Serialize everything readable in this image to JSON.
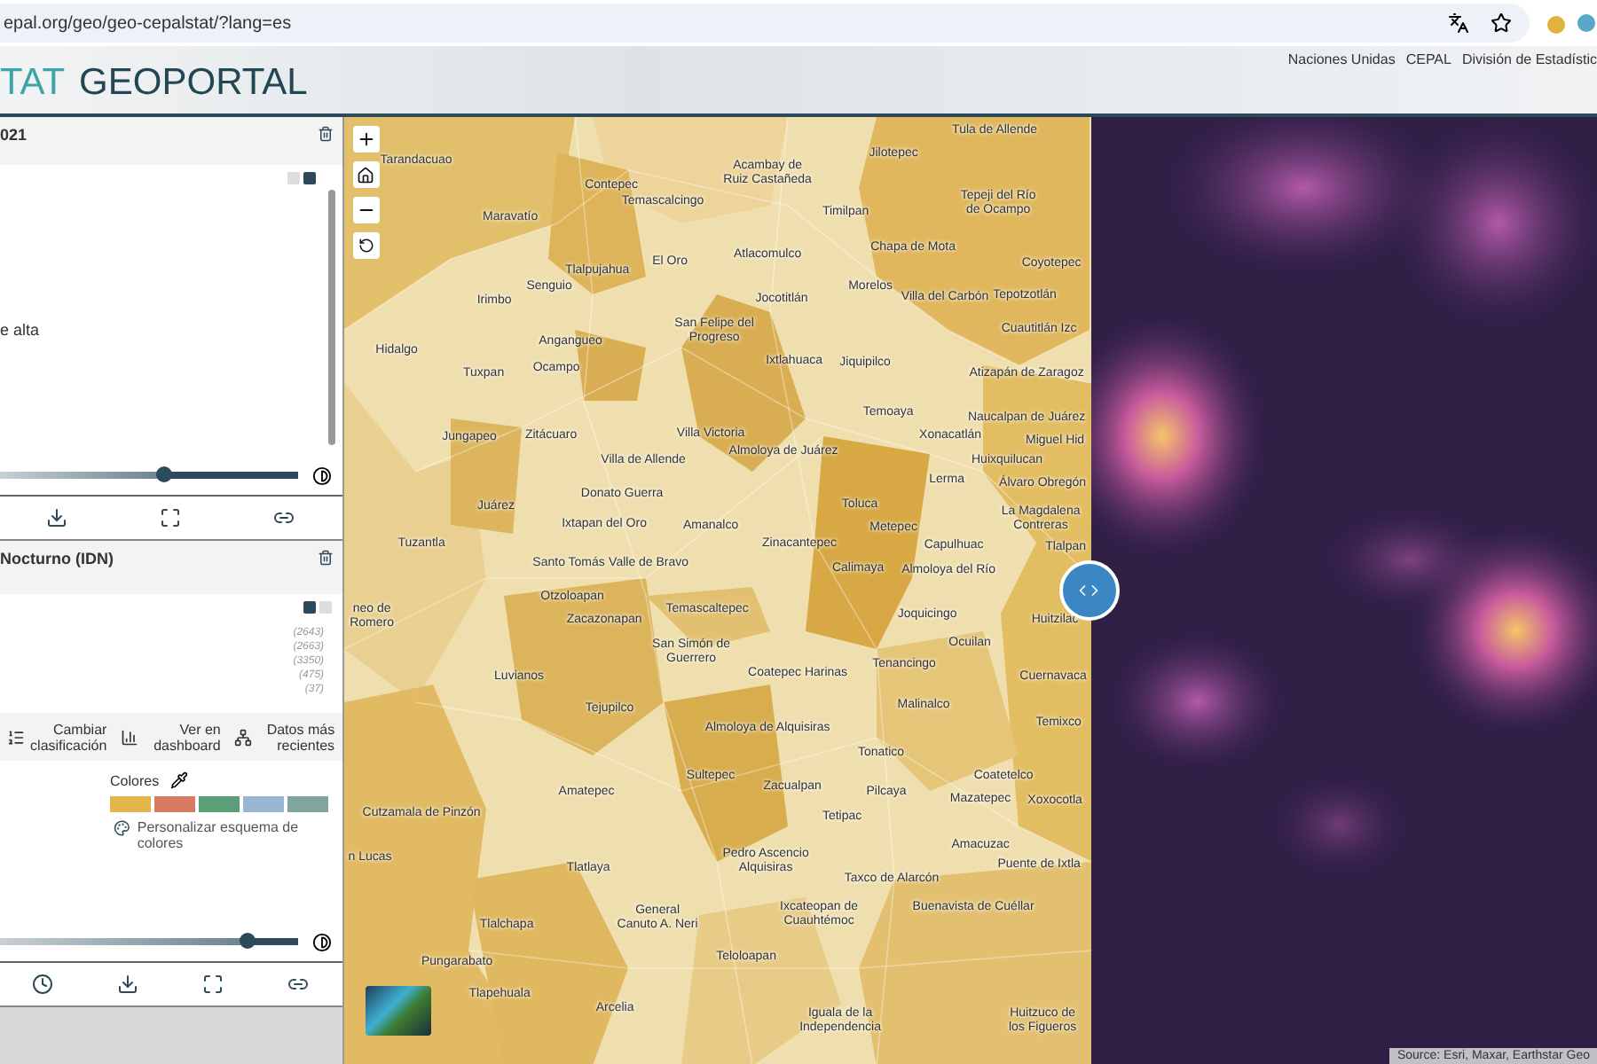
{
  "browser": {
    "url": "epal.org/geo/geo-cepalstat/?lang=es"
  },
  "header": {
    "logo_accent": "TAT",
    "logo_main": "GEOPORTAL",
    "links": [
      "Naciones Unidas",
      "CEPAL",
      "División de Estadístic"
    ]
  },
  "layers": [
    {
      "title": "021",
      "body_text": "e alta",
      "opacity": {
        "level": 0.55
      },
      "time_control": false
    },
    {
      "title": "Nocturno (IDN)",
      "counts": [
        "(2643)",
        "(2663)",
        "(3350)",
        "(475)",
        "(37)"
      ],
      "actions": [
        {
          "kind": "classify",
          "label": "Cambiar clasificación"
        },
        {
          "kind": "dashboard",
          "label": "Ver en dashboard"
        },
        {
          "kind": "latest",
          "label": "Datos más recientes"
        }
      ],
      "colors_label": "Colores",
      "swatches": [
        {
          "color": "#e3b64c"
        },
        {
          "color": "#d77b63"
        },
        {
          "color": "#5c9e78"
        },
        {
          "color": "#9ab4d4"
        },
        {
          "color": "#80a4a0"
        }
      ],
      "customize_label": "Personalizar esquema de colores",
      "opacity": {
        "level": 0.83
      },
      "time_control": true
    }
  ],
  "map": {
    "labels": [
      {
        "text": "Tula de Allende"
      },
      {
        "text": "Tarandacuao"
      },
      {
        "text": "Maravatío"
      },
      {
        "text": "Contepec"
      },
      {
        "text": "Temascalcingo"
      },
      {
        "text": "Acambay de Ruiz Castañeda"
      },
      {
        "text": "Jilotepec"
      },
      {
        "text": "Timilpan"
      },
      {
        "text": "Tepeji del Río de Ocampo"
      },
      {
        "text": "Tlalpujahua"
      },
      {
        "text": "El Oro"
      },
      {
        "text": "Atlacomulco"
      },
      {
        "text": "Chapa de Mota"
      },
      {
        "text": "Coyotepec"
      },
      {
        "text": "Irimbo"
      },
      {
        "text": "Senguio"
      },
      {
        "text": "Jocotitlán"
      },
      {
        "text": "Morelos"
      },
      {
        "text": "Villa del Carbón"
      },
      {
        "text": "Tepotzotlán"
      },
      {
        "text": "Hidalgo"
      },
      {
        "text": "Angangueo"
      },
      {
        "text": "Tuxpan"
      },
      {
        "text": "Ocampo"
      },
      {
        "text": "San Felipe del Progreso"
      },
      {
        "text": "Ixtlahuaca"
      },
      {
        "text": "Jiquipilco"
      },
      {
        "text": "Cuautitlán Izc"
      },
      {
        "text": "Atizapán de Zaragoz"
      },
      {
        "text": "Temoaya"
      },
      {
        "text": "Naucalpan de Juárez"
      },
      {
        "text": "Jungapeo"
      },
      {
        "text": "Zitácuaro"
      },
      {
        "text": "Villa Victoria"
      },
      {
        "text": "Xonacatlán"
      },
      {
        "text": "Villa de Allende"
      },
      {
        "text": "Almoloya de Juárez"
      },
      {
        "text": "Miguel Hid"
      },
      {
        "text": "Huixquilucan"
      },
      {
        "text": "Juárez"
      },
      {
        "text": "Donato Guerra"
      },
      {
        "text": "Toluca"
      },
      {
        "text": "Lerma"
      },
      {
        "text": "Álvaro Obregón"
      },
      {
        "text": "Ixtapan del Oro"
      },
      {
        "text": "Amanalco"
      },
      {
        "text": "Metepec"
      },
      {
        "text": "La Magdalena Contreras"
      },
      {
        "text": "Tuzantla"
      },
      {
        "text": "Zinacantepec"
      },
      {
        "text": "Capulhuac"
      },
      {
        "text": "Tlalpan"
      },
      {
        "text": "Santo Tomás"
      },
      {
        "text": "Valle de Bravo"
      },
      {
        "text": "Calimaya"
      },
      {
        "text": "Almoloya del Río"
      },
      {
        "text": "neo de Romero"
      },
      {
        "text": "Otzoloapan"
      },
      {
        "text": "Zacazonapan"
      },
      {
        "text": "Temascaltepec"
      },
      {
        "text": "Joquicingo"
      },
      {
        "text": "Huitzilac"
      },
      {
        "text": "Luvianos"
      },
      {
        "text": "San Simón de Guerrero"
      },
      {
        "text": "Coatepec Harinas"
      },
      {
        "text": "Tenancingo"
      },
      {
        "text": "Ocuilan"
      },
      {
        "text": "Cuernavaca"
      },
      {
        "text": "Tejupilco"
      },
      {
        "text": "Almoloya de Alquisiras"
      },
      {
        "text": "Malinalco"
      },
      {
        "text": "Temixco"
      },
      {
        "text": "Tonatico"
      },
      {
        "text": "Cutzamala de Pinzón"
      },
      {
        "text": "Amatepec"
      },
      {
        "text": "Sultepec"
      },
      {
        "text": "Zacualpan"
      },
      {
        "text": "Tetipac"
      },
      {
        "text": "Pilcaya"
      },
      {
        "text": "Coatetelco"
      },
      {
        "text": "Mazatepec"
      },
      {
        "text": "Xoxocotla"
      },
      {
        "text": "n Lucas"
      },
      {
        "text": "Tlatlaya"
      },
      {
        "text": "Pedro Ascencio Alquisiras"
      },
      {
        "text": "Taxco de Alarcón"
      },
      {
        "text": "Amacuzac"
      },
      {
        "text": "Puente de Ixtla"
      },
      {
        "text": "Tlalchapa"
      },
      {
        "text": "General Canuto A. Neri"
      },
      {
        "text": "Ixcateopan de Cuauhtémoc"
      },
      {
        "text": "Buenavista de Cuéllar"
      },
      {
        "text": "Pungarabato"
      },
      {
        "text": "Teloloapan"
      },
      {
        "text": "Tlapehuala"
      },
      {
        "text": "Arcelia"
      },
      {
        "text": "Iguala de la Independencia"
      },
      {
        "text": "Huitzuco de los Figueros"
      }
    ],
    "attribution": "Source: Esri, Maxar, Earthstar Geo"
  }
}
